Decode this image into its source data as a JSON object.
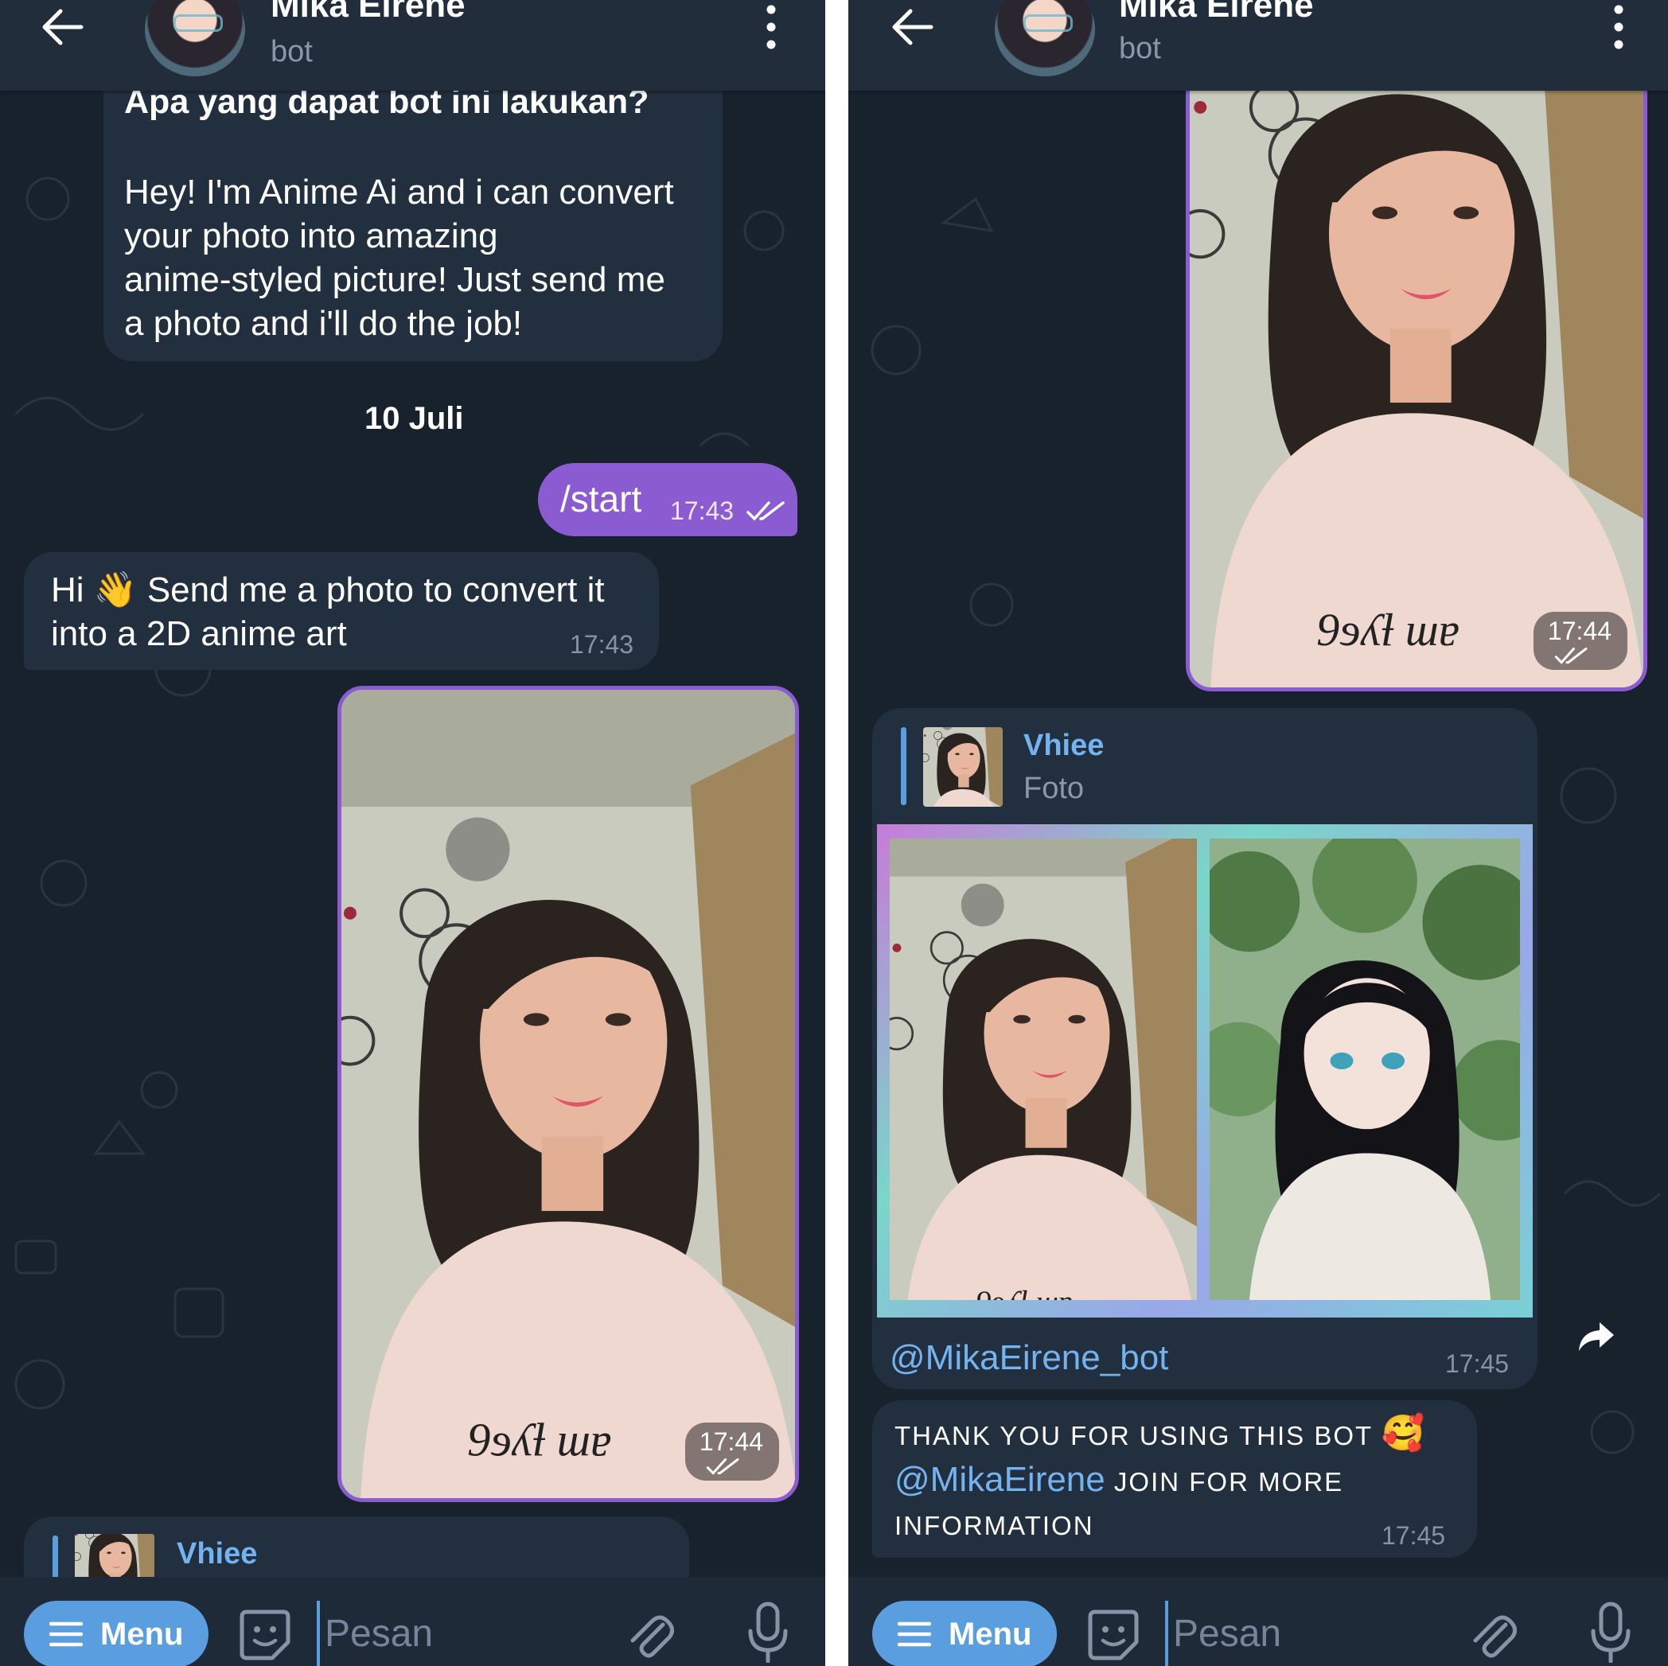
{
  "app": {
    "accent": "#8a5bd1",
    "link_color": "#73b3f0"
  },
  "header": {
    "name": "Mika Eirene",
    "subtitle": "bot",
    "icons": [
      "arrow-left-icon",
      "avatar",
      "more-vertical-icon"
    ]
  },
  "left": {
    "bot_intro": {
      "title": "Apa yang dapat bot ini lakukan?",
      "line1": "Hey! I'm Anime Ai and i can convert",
      "line2": "your photo into amazing",
      "line3": "anime-styled picture! Just send me",
      "line4": "a photo and i'll do the job!"
    },
    "date": "10 Juli",
    "start_msg": {
      "text": "/start",
      "time": "17:43"
    },
    "bot_reply": {
      "line1_pre": "Hi",
      "emoji": "👋",
      "line1_post": "Send me a photo to convert it",
      "line2": "into a 2D anime art",
      "time": "17:43"
    },
    "photo_msg": {
      "time": "17:44"
    },
    "reply_preview": {
      "name": "Vhiee"
    }
  },
  "right": {
    "photo_msg": {
      "time": "17:44"
    },
    "result_msg": {
      "reply_name": "Vhiee",
      "reply_type": "Foto",
      "link": "@MikaEirene_bot",
      "time": "17:45"
    },
    "thanks_msg": {
      "line1": "THANK YOU FOR USING THIS BOT",
      "emoji": "🥰",
      "mention": "@MikaEirene",
      "line2_rest": " JOIN FOR MORE",
      "line3": "INFORMATION",
      "time": "17:45"
    }
  },
  "input": {
    "menu_label": "Menu",
    "placeholder": "Pesan"
  }
}
